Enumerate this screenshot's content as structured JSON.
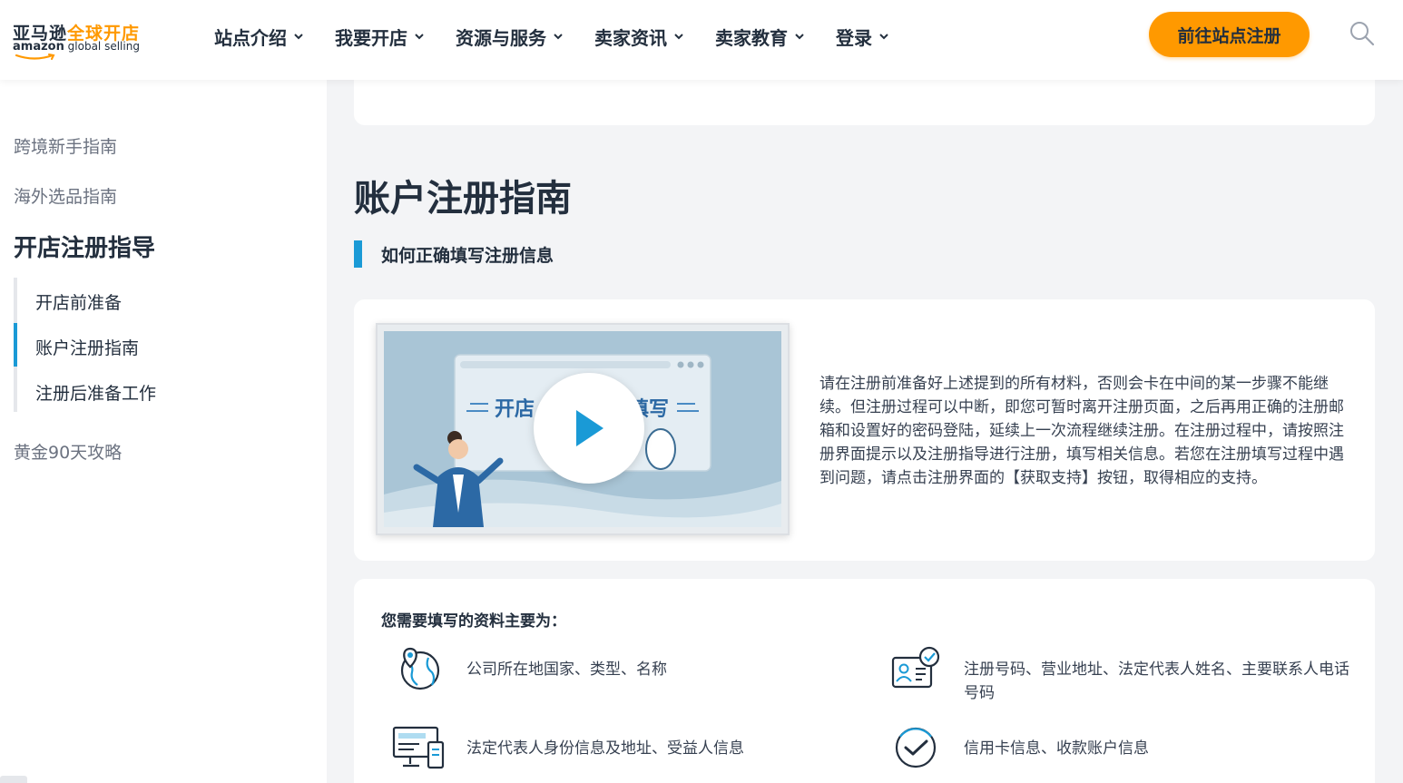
{
  "brand": {
    "cn_dark": "亚马逊",
    "cn_orange": "全球开店",
    "en_bold": "amazon",
    "en_rest": " global selling",
    "color_orange": "#ff9900",
    "color_dark": "#232f3e"
  },
  "nav": {
    "items": [
      "站点介绍",
      "我要开店",
      "资源与服务",
      "卖家资讯",
      "卖家教育",
      "登录"
    ],
    "cta": "前往站点注册",
    "search_icon": "search-icon"
  },
  "sidebar": {
    "link_1": "跨境新手指南",
    "link_2": "海外选品指南",
    "active_title": "开店注册指导",
    "sub_items": [
      "开店前准备",
      "账户注册指南",
      "注册后准备工作"
    ],
    "link_4": "黄金90天攻略",
    "accent_color": "#1a9ad6"
  },
  "main": {
    "title": "账户注册指南",
    "section_title": "如何正确填写注册信息",
    "video": {
      "banner_text_left": "开店",
      "banner_text_right": "填写",
      "play_icon": "play-icon"
    },
    "description": "请在注册前准备好上述提到的所有材料，否则会卡在中间的某一步骤不能继续。但注册过程可以中断，即您可暂时离开注册页面，之后再用正确的注册邮箱和设置好的密码登陆，延续上一次流程继续注册。在注册过程中，请按照注册界面提示以及注册指导进行注册，填写相关信息。若您在注册填写过程中遇到问题，请点击注册界面的【获取支持】按钮，取得相应的支持。",
    "list_heading": "您需要填写的资料主要为：",
    "items": [
      {
        "text": "公司所在地国家、类型、名称",
        "icon": "globe-location-icon"
      },
      {
        "text": "注册号码、营业地址、法定代表人姓名、主要联系人电话号码",
        "icon": "id-card-check-icon"
      },
      {
        "text": "法定代表人身份信息及地址、受益人信息",
        "icon": "devices-icon"
      },
      {
        "text": "信用卡信息、收款账户信息",
        "icon": "check-circle-icon"
      }
    ]
  }
}
